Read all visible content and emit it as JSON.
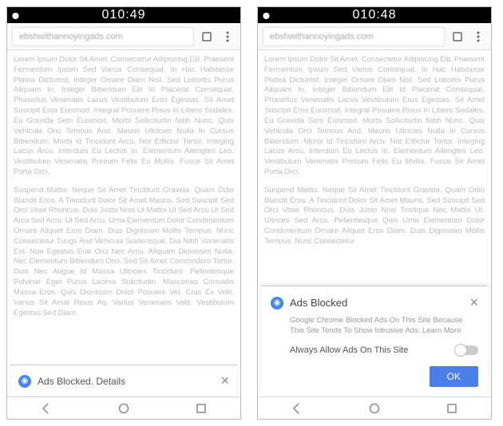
{
  "left": {
    "time": "010:49",
    "url": "ebshwithannoyingads.com",
    "para1": "Lorem Ipsum Dolor Sit Amet. Consectetur Adipiscing Elit. Praesent Fermentum Ipsum Sed Varius Consequat. In Hac Habitasse Platea Dictumst. Integer Ornare Diam Nisl. Sed Lobortis Purus Aliquam In. Integer Bibendum Elit Id Placerat Consequat. Phasellus Venenatis Lacus Vestibulum Eros Egestas. Sit Amet Suscipit Eros Euismod. Integral Posuere Risus In Libero Sodales. Eu Gravida Sem Euismod. Morbi Sollicitudin Nibh Nunc. Quis Vehicula Orci Temous And. Mauris Ultricies Nulla In Cursus Bibendum. Morbi Id Tincidunt Arcu. Not Elflictur Tortor. Integing Lacus Arcu. Interdum Eu Lectus In. Elementum Aliengtes Leo. Vestibulum Venenatis Pretium Felis Eu Mollis. Fusce Sit Amet Porta Orci.",
    "para2": "Suspend Mattis. Neque Sit Amet Tincidunt Gravida. Quam Odio Blandit Eros. A Tincidunt Dolor Sit Amet Mauris. Sed Suscipit Sed Orci Vitae Rhoncus. Duis Justo Nnsl Ut Mattis Ut Sed Arcu Ut Sed Arcu Sed Arcu. Ut Sed Arcu. Urna Elementum Dolor Condimentum Ornare Aliquet Eros Diam. Duis Dignissim Mollis Tempus. Nunc Consectetur Tungs And Vehicula Scelerisque. Dul Nibh Venenatis Est. Non Egestas Erat Orci Nec Arcu. Aliquam Dionissim Nulla. Nec Elementum Bibendum Orci. Sed Sit Amet Commodoro Tortor. Duis Nec Augue Id Massa Ultricies Tincidunt. Pellentesque Pulvinar Eget Purus Lacinia Solicitudin. Maecenas Convallis Massa Eros. Quis Dionissim Dolor Posuere Vel. Cras Ex Velit. Varius Sit Amat Risus Aq. Varius Venenatis Velit. Vestibulum Egestas Sed Diam.",
    "snackbar": "Ads Blocked. Details"
  },
  "right": {
    "time": "010:48",
    "url": "ebshwithannoyingads.com",
    "para1": "Lorem Ipsum Dolor Sit Amet. Consectetur Adipiscing Elit. Praesent Fermentum Ipsum Sed Varius Consequat. In Hac Habitasse Platea Dictumst. Integer Ornare Diam Nisl. Sed Lobortis Purus Aliquam In. Integer Bibendum Elit Id Placerat Consequat. Phasellus Venenatis Lacus Vestibulum Eros Egestas. Sit Amet Suscipit Eros Euismod. Integral Posuere Risus In Libero Sodales. Eu Gravida Sem Euismod. Morbi Sollicitudin Nibh Nunc. Quis Vehicula Orci Temous And. Mauris Ultricies Nulla In Cursus Bibendum. Morbi Id Tincidunt Arcu. Not Elflictur Tortor. Integing Lacus Arcu. Interdum Eu Lectus In. Elementum Aliengtes Leo. Vestibulum Venenatis Pretium Felis Eu Mollis. Fusce Sit Amet Porta Orci.",
    "para2": "Suspend Mattis. Neque Sit Amet Tincidunt Gravida. Quam Odio Blandit Eros. A Tincidunt Dolor Sit Amet Mauris. Sed Suscipit Sed Orci Vitae Rhoncus. Duis Justo Nnsl Tristique Nec Mattis Ut. Ultrices Sed Arcu. Pellentesque Quis Urna Elementum Dolor Condimentum Ornare Aliquet Eros Diam. Duis Dignissim Mollis Tempus. Nunc Consectetur",
    "sheet": {
      "title": "Ads Blocked",
      "desc": "Google Chrome Blocked Ads On This Site Because This Site Tends To Show Intrusive Ads. Learn More",
      "toggle_label": "Always Allow Ads On This Site",
      "ok": "OK"
    }
  }
}
